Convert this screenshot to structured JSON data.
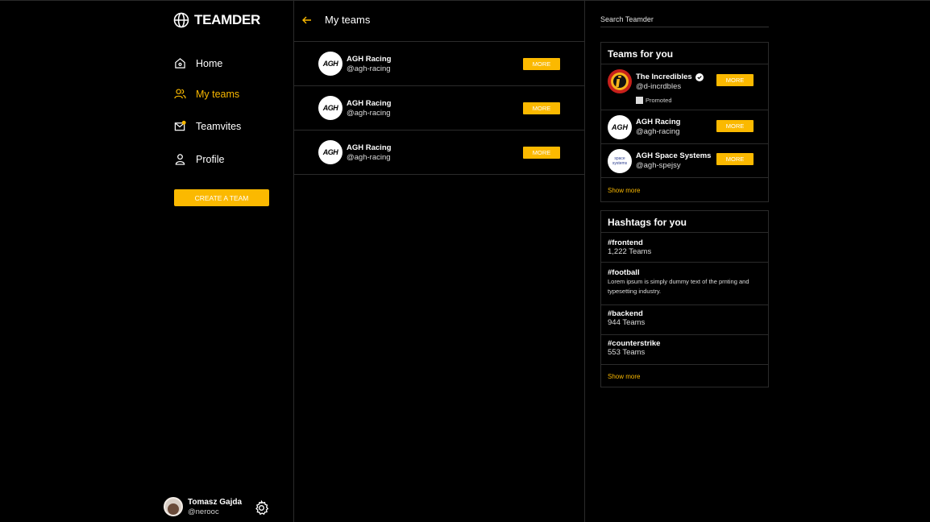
{
  "app": {
    "name": "TEAMDER"
  },
  "nav": {
    "items": [
      {
        "label": "Home",
        "icon": "home-icon",
        "active": false
      },
      {
        "label": "My teams",
        "icon": "people-icon",
        "active": true
      },
      {
        "label": "Teamvites",
        "icon": "mail-icon",
        "active": false
      },
      {
        "label": "Profile",
        "icon": "user-icon",
        "active": false
      }
    ],
    "create_label": "CREATE A TEAM"
  },
  "user": {
    "name": "Tomasz Gajda",
    "handle": "@nerooc"
  },
  "main": {
    "title": "My teams",
    "teams": [
      {
        "name": "AGH Racing",
        "handle": "@agh-racing",
        "logo_text": "AGH",
        "button": "MORE"
      },
      {
        "name": "AGH Racing",
        "handle": "@agh-racing",
        "logo_text": "AGH",
        "button": "MORE"
      },
      {
        "name": "AGH Racing",
        "handle": "@agh-racing",
        "logo_text": "AGH",
        "button": "MORE"
      }
    ]
  },
  "search": {
    "placeholder": "Search Teamder"
  },
  "teams_for_you": {
    "title": "Teams for you",
    "items": [
      {
        "name": "The Incredibles",
        "handle": "@d-incrdbles",
        "promoted": "Promoted",
        "button": "MORE"
      },
      {
        "name": "AGH Racing",
        "handle": "@agh-racing",
        "logo_text": "AGH",
        "button": "MORE"
      },
      {
        "name": "AGH Space Systems",
        "handle": "@agh-spejsy",
        "logo_text": "space systems",
        "button": "MORE"
      }
    ],
    "show_more": "Show more"
  },
  "hashtags": {
    "title": "Hashtags for you",
    "items": [
      {
        "tag": "#frontend",
        "count": "1,222 Teams"
      },
      {
        "tag": "#football",
        "desc": "Lorem ipsum is simply dummy text of the prnting and typesetting industry."
      },
      {
        "tag": "#backend",
        "count": "944 Teams"
      },
      {
        "tag": "#counterstrike",
        "count": "553 Teams"
      }
    ],
    "show_more": "Show more"
  },
  "colors": {
    "accent": "#fbb900",
    "background": "#000000",
    "border": "#2b2b2b"
  }
}
